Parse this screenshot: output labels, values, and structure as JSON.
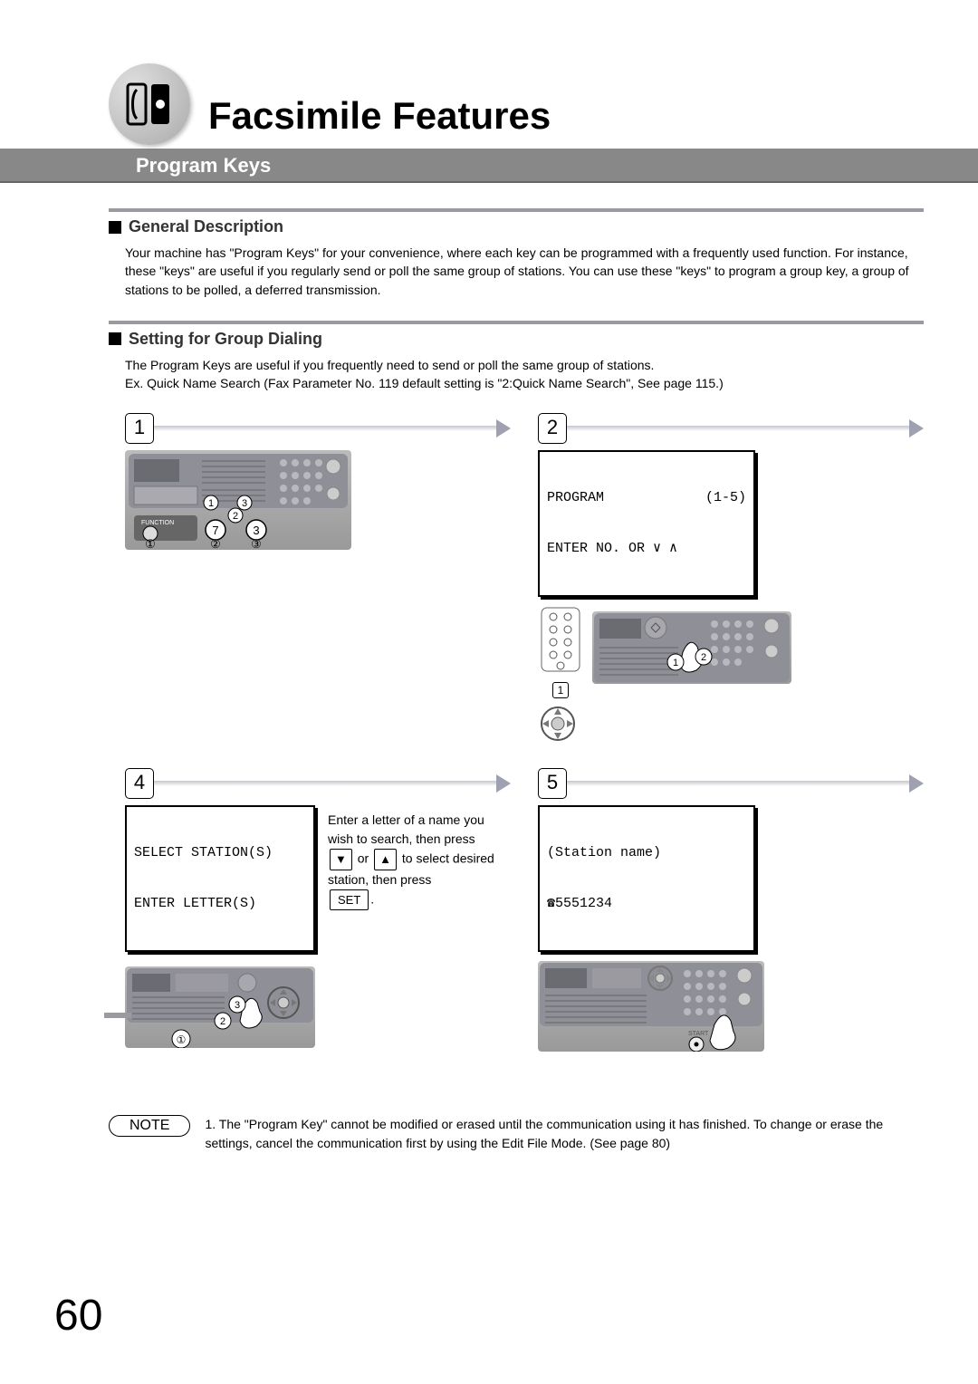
{
  "chapter_title": "Facsimile Features",
  "subtitle": "Program Keys",
  "section1": {
    "title": "General Description",
    "text": "Your machine has \"Program Keys\" for your convenience, where each key can be programmed with a frequently used function. For instance, these \"keys\" are useful if you regularly send or poll the same group of stations. You can use these \"keys\" to program a group key, a group of stations to be polled, a deferred transmission."
  },
  "section2": {
    "title": "Setting for Group Dialing",
    "line1": "The Program Keys are useful if you frequently need to send or poll the same group of stations.",
    "line2": "Ex. Quick Name Search (Fax Parameter No. 119 default setting is \"2:Quick Name Search\", See page 115.)"
  },
  "steps": {
    "s1": "1",
    "s2": "2",
    "s4": "4",
    "s5": "5"
  },
  "lcd2": {
    "left": "PROGRAM",
    "right": "(1-5)",
    "line2": "ENTER NO. OR ∨ ∧"
  },
  "lcd4": {
    "line1": "SELECT STATION(S)",
    "line2": "ENTER LETTER(S)"
  },
  "lcd5": {
    "line1": "(Station name)",
    "line2": "☎5551234"
  },
  "instr4": {
    "l1": "Enter a letter of a name you wish to search, then press",
    "l2_mid": " or ",
    "l2_end": " to select desired station, then press",
    "set_label": "SET",
    "period": "."
  },
  "markers": {
    "c1": "①",
    "c2": "②",
    "c3": "③",
    "n1": "1",
    "n2": "2",
    "n3": "3",
    "n7": "7"
  },
  "note": {
    "label": "NOTE",
    "text": "1. The \"Program Key\" cannot be modified or erased until the communication using it has finished. To change or erase the settings, cancel the communication first by using the Edit File Mode. (See page 80)"
  },
  "page_number": "60"
}
